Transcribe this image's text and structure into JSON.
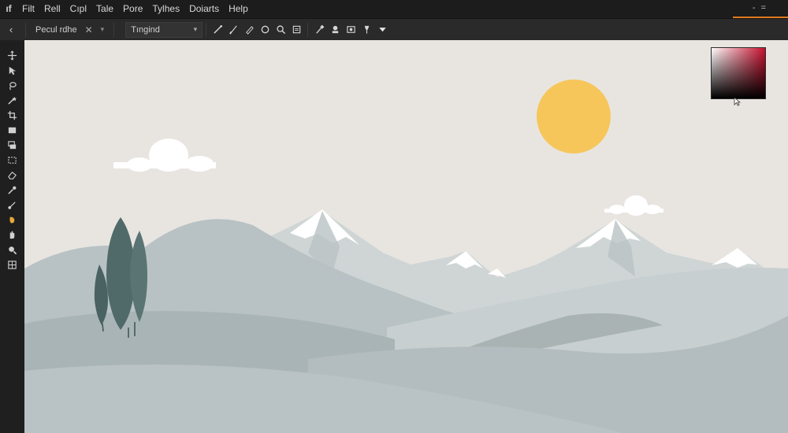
{
  "menu": {
    "app_logo": "ıf",
    "items": [
      "Filt",
      "Rell",
      "Cıpl",
      "Tale",
      "Pore",
      "Tylhes",
      "Doiarts",
      "Help"
    ],
    "right_controls": "- ="
  },
  "options_bar": {
    "back_glyph": "‹",
    "preset_label": "Pecul rdhe",
    "close_glyph": "✕",
    "mode_value": "Tıngind"
  },
  "colors": {
    "accent": "#e07a1f",
    "sun": "#f7c65b",
    "sky": "#e8e5e1",
    "snow": "#ffffff",
    "tree": "#4f6a69",
    "picker_hue": "#c8102e"
  },
  "icons": {
    "toolbar": [
      "brush-icon",
      "pen-icon",
      "pencil-icon",
      "lasso-icon",
      "search-icon",
      "frame-icon",
      "eyedropper-icon",
      "stamp-icon",
      "layers-icon",
      "pin-icon",
      "dropdown-arrow-icon"
    ],
    "tools": [
      "move-icon",
      "selection-icon",
      "lasso-icon",
      "magic-wand-icon",
      "crop-icon",
      "rectangle-icon",
      "layer-icon",
      "marquee-icon",
      "eraser-icon",
      "eyedropper-icon",
      "brush-icon",
      "color-swatch-icon",
      "hand-icon",
      "zoom-icon",
      "grid-icon"
    ]
  }
}
